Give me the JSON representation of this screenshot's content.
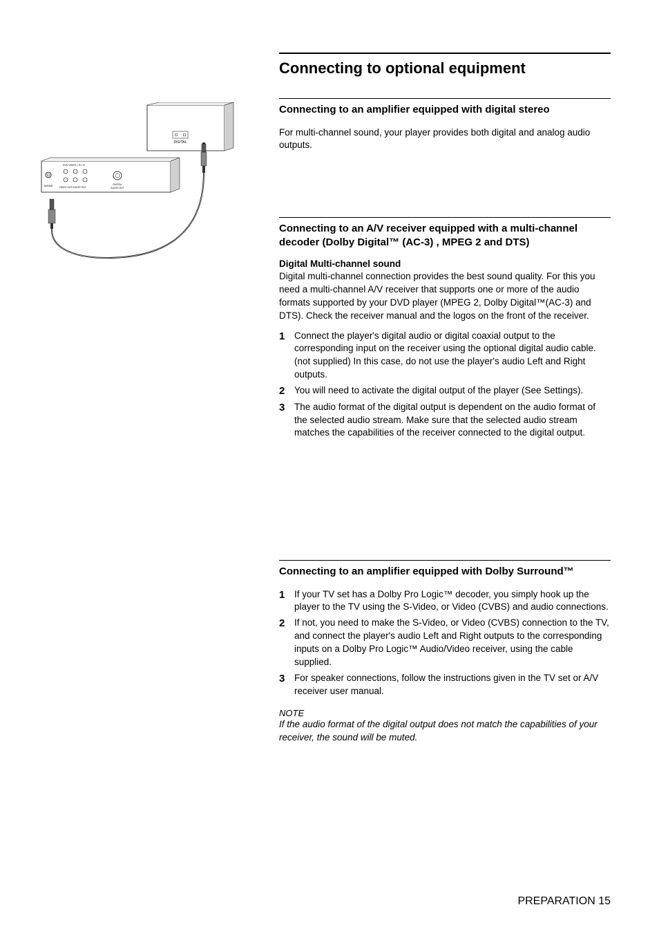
{
  "mainTitle": "Connecting to optional equipment",
  "section1": {
    "heading": "Connecting to an amplifier equipped with digital stereo",
    "body": "For multi-channel sound, your player provides both digital and analog audio outputs."
  },
  "section2": {
    "heading": "Connecting to an A/V receiver equipped with a multi-channel decoder (Dolby Digital™ (AC-3) , MPEG 2 and DTS)",
    "subHeading": "Digital Multi-channel sound",
    "body": "Digital multi-channel connection provides the best sound quality. For this you need a multi-channel A/V receiver that supports one or more of the audio formats supported by your DVD player (MPEG 2, Dolby Digital™(AC-3) and DTS). Check the receiver manual and the logos on the front of the receiver.",
    "items": [
      "Connect the player's digital audio or digital coaxial output to the corresponding input on the receiver using the optional digital audio cable.(not supplied) In this case, do not use the player's audio Left and Right outputs.",
      "You will need to activate the digital output of the player (See Settings).",
      "The audio format of the digital output is dependent on the audio format of the selected audio stream. Make sure that the selected audio stream matches the capabilities of the receiver connected to the digital output."
    ]
  },
  "section3": {
    "heading": "Connecting to an amplifier equipped with Dolby Surround™",
    "items": [
      "If your TV set has a Dolby Pro Logic™ decoder, you simply hook up the player to the TV using the S-Video, or Video (CVBS) and audio connections.",
      "If not, you need to make the S-Video, or Video (CVBS) connection to the TV, and connect the player's audio Left and Right outputs to the corresponding inputs on a Dolby Pro Logic™ Audio/Video receiver, using the cable supplied.",
      "For speaker connections, follow the instructions given in the TV set or A/V receiver user manual."
    ],
    "noteLabel": "NOTE",
    "noteText": "If the audio format of the digital output does not match the capabilities of your receiver, the sound will be muted."
  },
  "footer": {
    "label": "PREPARATION",
    "page": "15"
  }
}
